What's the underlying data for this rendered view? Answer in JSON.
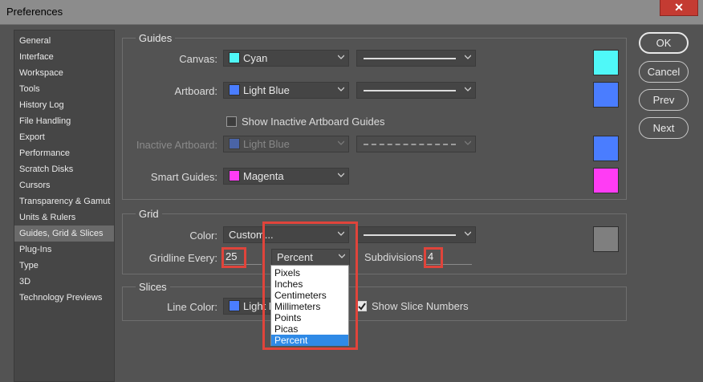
{
  "window": {
    "title": "Preferences",
    "close_glyph": "✕"
  },
  "sidebar": {
    "items": [
      {
        "label": "General"
      },
      {
        "label": "Interface"
      },
      {
        "label": "Workspace"
      },
      {
        "label": "Tools"
      },
      {
        "label": "History Log"
      },
      {
        "label": "File Handling"
      },
      {
        "label": "Export"
      },
      {
        "label": "Performance"
      },
      {
        "label": "Scratch Disks"
      },
      {
        "label": "Cursors"
      },
      {
        "label": "Transparency & Gamut"
      },
      {
        "label": "Units & Rulers"
      },
      {
        "label": "Guides, Grid & Slices"
      },
      {
        "label": "Plug-Ins"
      },
      {
        "label": "Type"
      },
      {
        "label": "3D"
      },
      {
        "label": "Technology Previews"
      }
    ],
    "selected": "Guides, Grid & Slices"
  },
  "buttons": {
    "ok": "OK",
    "cancel": "Cancel",
    "prev": "Prev",
    "next": "Next"
  },
  "guides": {
    "title": "Guides",
    "canvas": {
      "label": "Canvas:",
      "color": "Cyan",
      "swatch": "#4ff8f8"
    },
    "artboard": {
      "label": "Artboard:",
      "color": "Light Blue",
      "swatch": "#4a7dff"
    },
    "show_inactive": {
      "label": "Show Inactive Artboard Guides",
      "checked": false
    },
    "inactive_artboard": {
      "label": "Inactive Artboard:",
      "color": "Light Blue",
      "swatch": "#4a7dff"
    },
    "smart_guides": {
      "label": "Smart Guides:",
      "color": "Magenta",
      "swatch": "#ff3cf4"
    }
  },
  "grid": {
    "title": "Grid",
    "color": {
      "label": "Color:",
      "value": "Custom...",
      "swatch": "#7f7f7f"
    },
    "gridline_every": {
      "label": "Gridline Every:",
      "value": "25",
      "unit": "Percent"
    },
    "subdivisions": {
      "label": "Subdivisions:",
      "value": "4"
    },
    "unit_options": [
      "Pixels",
      "Inches",
      "Centimeters",
      "Millimeters",
      "Points",
      "Picas",
      "Percent"
    ],
    "unit_selected": "Percent"
  },
  "slices": {
    "title": "Slices",
    "line_color": {
      "label": "Line Color:",
      "value": "Light Blue",
      "swatch": "#4a7dff"
    },
    "show_numbers": {
      "label": "Show Slice Numbers",
      "checked": true
    }
  },
  "colors": {
    "highlight": "#e0443b",
    "menu_selected": "#2f8ae6"
  }
}
